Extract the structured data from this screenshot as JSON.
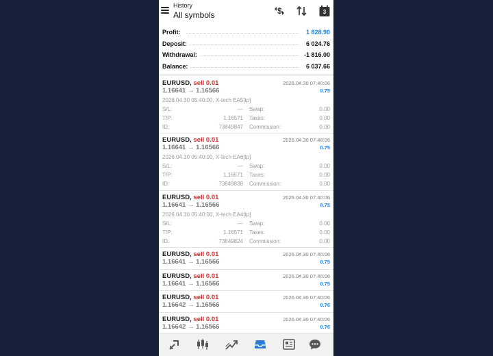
{
  "header": {
    "subtitle": "History",
    "title": "All symbols",
    "calendar_day": "3",
    "icons": [
      "menu-icon",
      "dollar-swap-icon",
      "sort-icon",
      "calendar-icon"
    ]
  },
  "summary": [
    {
      "label": "Profit:",
      "value": "1 828.90",
      "color": "#1a82e8"
    },
    {
      "label": "Deposit:",
      "value": "6 024.76"
    },
    {
      "label": "Withdrawal:",
      "value": "-1 816.00"
    },
    {
      "label": "Balance:",
      "value": "6 037.66"
    }
  ],
  "deals": [
    {
      "symbol": "EURUSD,",
      "action": "sell 0.01",
      "prices": "1.16641 → 1.16566",
      "close_time": "2026.04.30 07:40:06",
      "profit": "0.75",
      "open_info": "2026.04.30 05:40:00, X-tech EA5[tp]",
      "sl_label": "S/L:",
      "sl": "—",
      "tp_label": "T/P:",
      "tp": "1.16571",
      "id_label": "ID:",
      "id": "73849847",
      "swap_label": "Swap:",
      "swap": "0.00",
      "taxes_label": "Taxes:",
      "taxes": "0.00",
      "commission_label": "Commission:",
      "commission": "0.00"
    },
    {
      "symbol": "EURUSD,",
      "action": "sell 0.01",
      "prices": "1.16641 → 1.16566",
      "close_time": "2026.04.30 07:40:06",
      "profit": "0.75",
      "open_info": "2026.04.30 05:40:00, X-tech EA6[tp]",
      "sl_label": "S/L:",
      "sl": "—",
      "tp_label": "T/P:",
      "tp": "1.16571",
      "id_label": "ID:",
      "id": "73849838",
      "swap_label": "Swap:",
      "swap": "0.00",
      "taxes_label": "Taxes:",
      "taxes": "0.00",
      "commission_label": "Commission:",
      "commission": "0.00"
    },
    {
      "symbol": "EURUSD,",
      "action": "sell 0.01",
      "prices": "1.16641 → 1.16566",
      "close_time": "2026.04.30 07:40:06",
      "profit": "0.75",
      "open_info": "2026.04.30 05:40:00, X-tech EA4[tp]",
      "sl_label": "S/L:",
      "sl": "—",
      "tp_label": "T/P:",
      "tp": "1.16571",
      "id_label": "ID:",
      "id": "73849824",
      "swap_label": "Swap:",
      "swap": "0.00",
      "taxes_label": "Taxes:",
      "taxes": "0.00",
      "commission_label": "Commission:",
      "commission": "0.00"
    },
    {
      "symbol": "EURUSD,",
      "action": "sell 0.01",
      "prices": "1.16641 → 1.16566",
      "close_time": "2026.04.30 07:40:06",
      "profit": "0.75"
    },
    {
      "symbol": "EURUSD,",
      "action": "sell 0.01",
      "prices": "1.16641 → 1.16566",
      "close_time": "2026.04.30 07:40:06",
      "profit": "0.75"
    },
    {
      "symbol": "EURUSD,",
      "action": "sell 0.01",
      "prices": "1.16642 → 1.16566",
      "close_time": "2026.04.30 07:40:06",
      "profit": "0.76"
    },
    {
      "symbol": "EURUSD,",
      "action": "sell 0.01",
      "prices": "1.16642 → 1.16566",
      "close_time": "2026.04.30 07:40:06",
      "profit": "0.76"
    }
  ],
  "bottom_nav": [
    {
      "icon": "quotes-icon",
      "active": false
    },
    {
      "icon": "candlestick-chart-icon",
      "active": false
    },
    {
      "icon": "trade-icon",
      "active": false
    },
    {
      "icon": "history-inbox-icon",
      "active": true
    },
    {
      "icon": "news-icon",
      "active": false
    },
    {
      "icon": "messages-icon",
      "active": false
    }
  ],
  "colors": {
    "background": "#18213a",
    "accent_blue": "#1a82e8",
    "sell_red": "#d03030",
    "nav_active": "#2a7fd4",
    "nav_inactive": "#555555"
  }
}
